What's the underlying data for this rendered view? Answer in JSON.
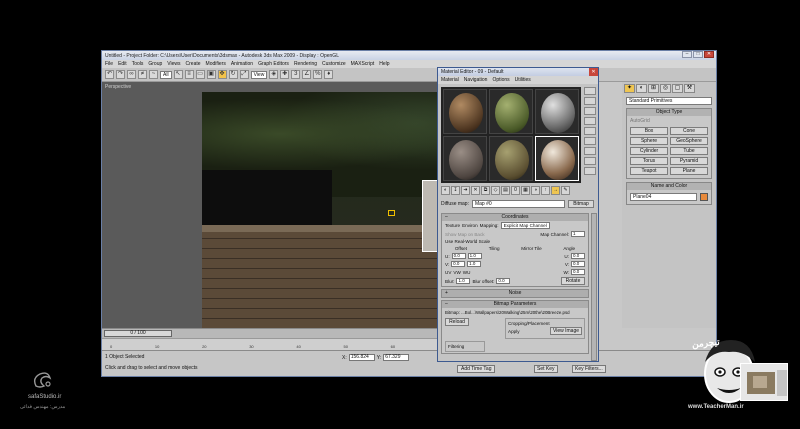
{
  "window": {
    "title": "Untitled - Project Folder: C:\\Users\\User\\Documents\\3dsmax - Autodesk 3ds Max 2009 - Display : OpenGL"
  },
  "menu": [
    "File",
    "Edit",
    "Tools",
    "Group",
    "Views",
    "Create",
    "Modifiers",
    "Animation",
    "Graph Editors",
    "Rendering",
    "Customize",
    "MAXScript",
    "Help"
  ],
  "toolbar": {
    "selection_filter": "All",
    "reference_coord": "View"
  },
  "viewport": {
    "label": "Perspective"
  },
  "command_panel": {
    "category": "Standard Primitives",
    "object_type_header": "Object Type",
    "autogrid": "AutoGrid",
    "object_buttons": [
      "Box",
      "Cone",
      "Sphere",
      "GeoSphere",
      "Cylinder",
      "Tube",
      "Torus",
      "Pyramid",
      "Teapot",
      "Plane"
    ],
    "name_color_header": "Name and Color",
    "object_name": "Plane04",
    "object_color": "#e88a3c"
  },
  "timebar": {
    "slider": "0 / 100",
    "ticks": [
      "0",
      "10",
      "20",
      "30",
      "40",
      "50",
      "60",
      "70",
      "80",
      "90",
      "100"
    ]
  },
  "status": {
    "selection": "1 Object Selected",
    "hint": "Click and drag to select and move objects",
    "coord_x_label": "X:",
    "coord_x": "156.824",
    "coord_y_label": "Y:",
    "coord_y": "67.329",
    "add_time_tag": "Add Time Tag",
    "set_key": "Set Key",
    "key_filters": "Key Filters..."
  },
  "material_editor": {
    "title": "Material Editor - 09 - Default",
    "menu": [
      "Material",
      "Navigation",
      "Options",
      "Utilities"
    ],
    "diffuse_label": "Diffuse map:",
    "map_name": "Map #0",
    "map_type": "Bitmap",
    "coordinates_header": "Coordinates",
    "texture": "Texture",
    "environ": "Environ",
    "mapping_label": "Mapping:",
    "mapping_value": "Explicit Map Channel",
    "show_map_on_back": "Show Map on Back",
    "map_channel_label": "Map Channel:",
    "map_channel_value": "1",
    "use_real_world": "Use Real-World Scale",
    "col_offset": "Offset",
    "col_tiling": "Tiling",
    "col_mirror_tile": "Mirror Tile",
    "col_angle": "Angle",
    "u_label": "U:",
    "v_label": "V:",
    "w_label": "W:",
    "u_offset": "0.0",
    "v_offset": "0.0",
    "u_tiling": "1.0",
    "v_tiling": "1.0",
    "u_angle": "0.0",
    "v_angle": "0.0",
    "w_angle": "0.0",
    "uv": "UV",
    "vw": "VW",
    "wu": "WU",
    "blur_label": "Blur:",
    "blur": "1.0",
    "blur_offset_label": "Blur offset:",
    "blur_offset": "0.0",
    "rotate": "Rotate",
    "noise_header": "Noise",
    "bitmap_params_header": "Bitmap Parameters",
    "bitmap_path": "Bitmap: ...Bol...\\Wallpapers\\20Walking\\25m\\20the\\20Breeze.psd",
    "reload": "Reload",
    "cropping_header": "Cropping/Placement",
    "apply": "Apply",
    "view_image": "View Image",
    "filtering": "Filtering"
  },
  "watermark": {
    "site": "safaStudio.ir",
    "teacher_site": "www.TeacherMan.ir",
    "teacher_logo": "تیچرمن"
  }
}
